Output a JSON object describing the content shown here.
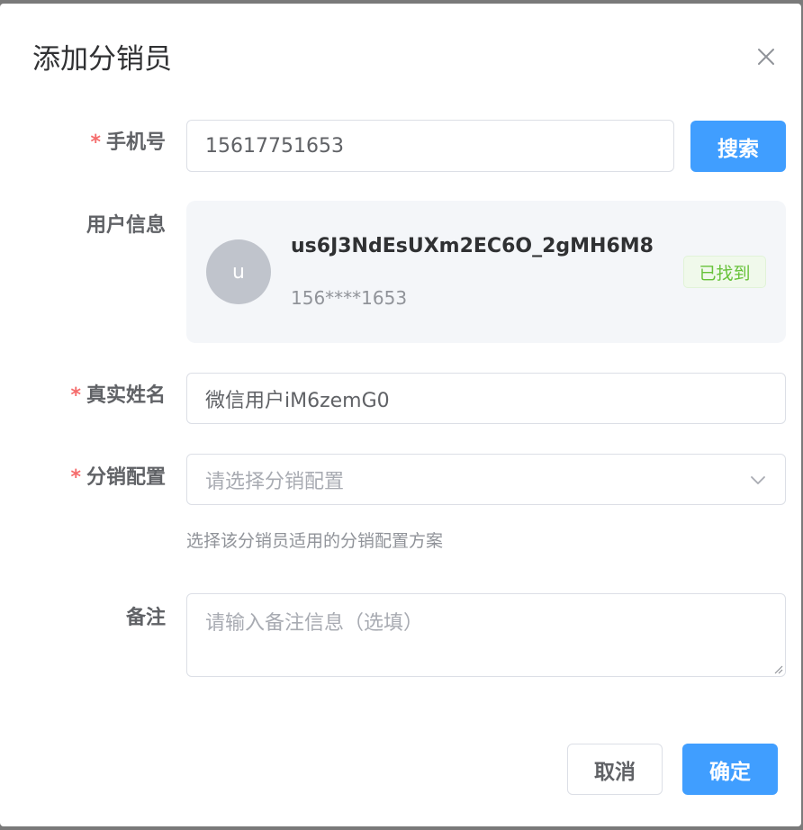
{
  "dialog": {
    "title": "添加分销员",
    "close_icon": "close-icon"
  },
  "form": {
    "required_mark": "*",
    "phone": {
      "label": "手机号",
      "value": "15617751653",
      "search_button": "搜索"
    },
    "user_info": {
      "label": "用户信息",
      "avatar_letter": "u",
      "username": "us6J3NdEsUXm2EC6O_2gMH6M8",
      "masked_phone": "156****1653",
      "status_badge": "已找到",
      "status_color": "#67c23a"
    },
    "real_name": {
      "label": "真实姓名",
      "value": "微信用户iM6zemG0"
    },
    "distribution_config": {
      "label": "分销配置",
      "placeholder": "请选择分销配置",
      "hint": "选择该分销员适用的分销配置方案",
      "dropdown_icon": "chevron-down-icon"
    },
    "remark": {
      "label": "备注",
      "placeholder": "请输入备注信息（选填）"
    }
  },
  "footer": {
    "cancel_label": "取消",
    "confirm_label": "确定"
  },
  "colors": {
    "primary": "#409eff",
    "required": "#f56c6c",
    "success": "#67c23a"
  }
}
